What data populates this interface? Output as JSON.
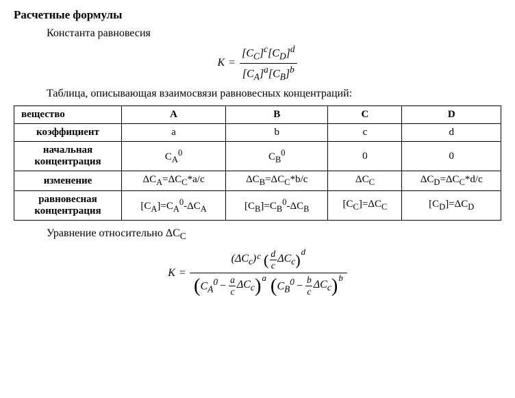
{
  "heading": "Расчетные формулы",
  "subheading": "Константа равновесия",
  "formula1": {
    "lhs": "K",
    "eq": "=",
    "num_html": "[<i>C</i><sub><i>C</i></sub>]<sup><i>c</i></sup>[<i>C</i><sub><i>D</i></sub>]<sup><i>d</i></sup>",
    "den_html": "[<i>C</i><sub><i>A</i></sub>]<sup><i>a</i></sup>[<i>C</i><sub><i>B</i></sub>]<sup><i>b</i></sup>"
  },
  "table_caption": "Таблица, описывающая взаимосвязи равновесных концентраций:",
  "table": {
    "headers": [
      "вещество",
      "A",
      "B",
      "C",
      "D"
    ],
    "rows": [
      {
        "label_html": "коэффициент",
        "cells_html": [
          "a",
          "b",
          "c",
          "d"
        ]
      },
      {
        "label_html": "начальная<br>концентрация",
        "cells_html": [
          "C<sub>A</sub><sup>0</sup>",
          "C<sub>B</sub><sup>0</sup>",
          "0",
          "0"
        ]
      },
      {
        "label_html": "изменение",
        "cells_html": [
          "ΔC<sub>A</sub>=ΔC<sub>C</sub>*a/c",
          "ΔC<sub>B</sub>=ΔC<sub>C</sub>*b/c",
          "ΔC<sub>C</sub>",
          "ΔC<sub>D</sub>=ΔC<sub>C</sub>*d/c"
        ]
      },
      {
        "label_html": "равновесная<br>концентрация",
        "cells_html": [
          "[C<sub>A</sub>]=C<sub>A</sub><sup>0</sup>-ΔC<sub>A</sub>",
          "[C<sub>B</sub>]=C<sub>B</sub><sup>0</sup>-ΔC<sub>B</sub>",
          "[C<sub>C</sub>]=ΔC<sub>C</sub>",
          "[C<sub>D</sub>]=ΔC<sub>D</sub>"
        ]
      }
    ]
  },
  "equation_footer_html": "Уравнение относительно ΔC<sub>C</sub>",
  "formula2": {
    "lhs": "K",
    "eq": "=",
    "num": {
      "t1_base_html": "(Δ<i>C</i><sub><i>c</i></sub>)",
      "t1_exp": "c",
      "t2_inner_frac": {
        "n": "d",
        "d": "c"
      },
      "t2_tail_html": "Δ<i>C</i><sub><i>c</i></sub>",
      "t2_exp": "d"
    },
    "den": {
      "g1_lead_html": "<i>C</i><sub><i>A</i></sub><sup>0</sup>",
      "g1_minus": "−",
      "g1_frac": {
        "n": "a",
        "d": "c"
      },
      "g1_tail_html": "Δ<i>C</i><sub><i>c</i></sub>",
      "g1_exp": "a",
      "g2_lead_html": "<i>C</i><sub><i>B</i></sub><sup>0</sup>",
      "g2_minus": "−",
      "g2_frac": {
        "n": "b",
        "d": "c"
      },
      "g2_tail_html": "Δ<i>C</i><sub><i>c</i></sub>",
      "g2_exp": "b"
    }
  }
}
